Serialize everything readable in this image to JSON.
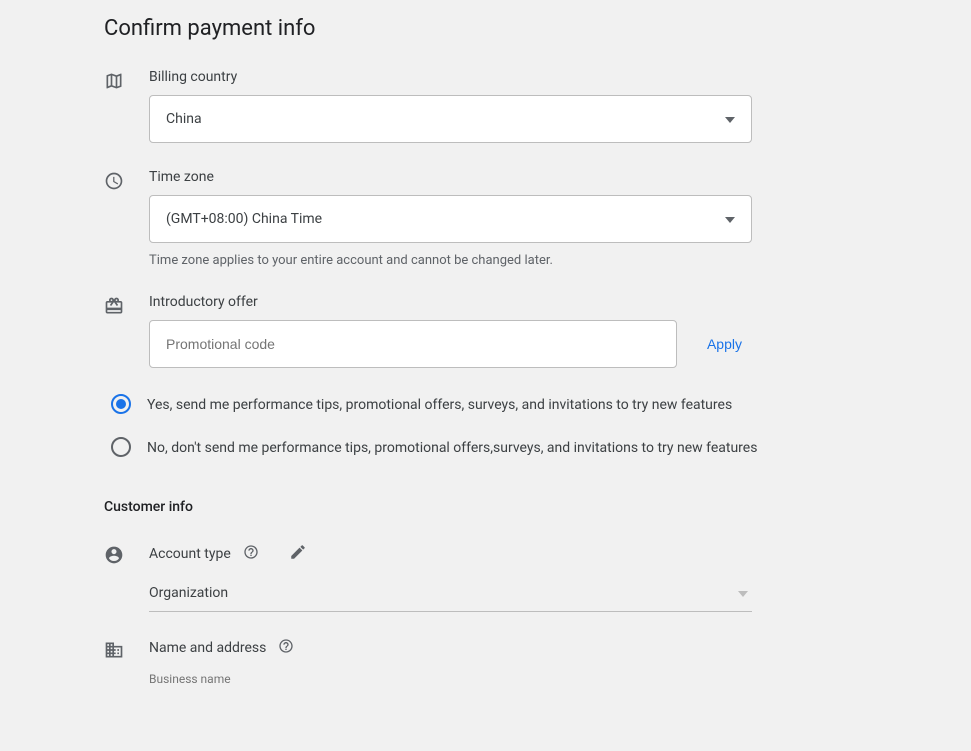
{
  "page_title": "Confirm payment info",
  "billing": {
    "label": "Billing country",
    "value": "China"
  },
  "timezone": {
    "label": "Time zone",
    "value": "(GMT+08:00) China Time",
    "helper": "Time zone applies to your entire account and cannot be changed later."
  },
  "offer": {
    "label": "Introductory offer",
    "placeholder": "Promotional code",
    "apply_label": "Apply"
  },
  "tips": {
    "yes_label": "Yes, send me performance tips, promotional offers, surveys, and invitations to try new features",
    "no_label": "No, don't send me performance tips, promotional offers,surveys, and invitations to try new features"
  },
  "customer": {
    "heading": "Customer info",
    "account_type_label": "Account type",
    "account_type_value": "Organization",
    "name_address_label": "Name and address",
    "business_name_label": "Business name"
  }
}
